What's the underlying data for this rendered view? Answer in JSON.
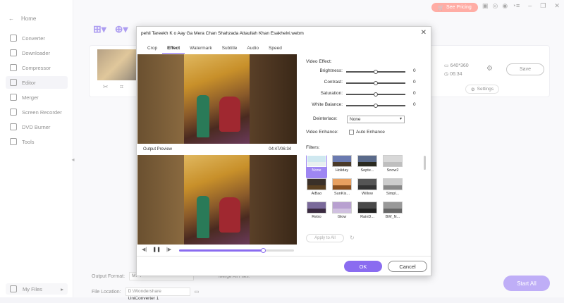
{
  "sidebar": {
    "home": "Home",
    "items": [
      {
        "label": "Converter",
        "icon": "converter-icon"
      },
      {
        "label": "Downloader",
        "icon": "downloader-icon"
      },
      {
        "label": "Compressor",
        "icon": "compressor-icon"
      },
      {
        "label": "Editor",
        "icon": "editor-icon",
        "active": true
      },
      {
        "label": "Merger",
        "icon": "merger-icon"
      },
      {
        "label": "Screen Recorder",
        "icon": "screen-recorder-icon"
      },
      {
        "label": "DVD Burner",
        "icon": "dvd-burner-icon"
      },
      {
        "label": "Tools",
        "icon": "tools-icon"
      }
    ],
    "my_files": "My Files"
  },
  "topbar": {
    "pricing_label": "See Pricing",
    "accent": "#ff6b5c"
  },
  "background": {
    "resolution": "640*360",
    "duration": "06:34",
    "save_label": "Save",
    "settings_label": "Settings",
    "output_format_label": "Output Format:",
    "output_format_value": "MP4",
    "merge_label": "Merge All Files:",
    "file_location_label": "File Location:",
    "file_location_value": "D:\\Wondershare UniConverter 1",
    "start_all_label": "Start All"
  },
  "dialog": {
    "title": "pehli Tareekh K o Aay Ga Mera Chan Shahzada Attaullah Khan Esakhelvi.webm",
    "tabs": [
      "Crop",
      "Effect",
      "Watermark",
      "Subtitle",
      "Audio",
      "Speed"
    ],
    "active_tab": "Effect",
    "output_preview_label": "Output Preview",
    "time": "04:47/06:34",
    "playback_progress": 0.73,
    "video_effect_label": "Video Effect:",
    "sliders": [
      {
        "label": "Brightness:",
        "value": "0",
        "position": 0.5
      },
      {
        "label": "Contrast:",
        "value": "0",
        "position": 0.5
      },
      {
        "label": "Saturation:",
        "value": "0",
        "position": 0.5
      },
      {
        "label": "White Balance:",
        "value": "0",
        "position": 0.5
      }
    ],
    "deinterlace_label": "Deinterlace:",
    "deinterlace_value": "None",
    "video_enhance_label": "Video Enhance:",
    "auto_enhance_label": "Auto Enhance",
    "filters_label": "Filters:",
    "filters": [
      "None",
      "Holiday",
      "Septe...",
      "Snow2",
      "AiBao",
      "SunKis...",
      "Willow",
      "Simpl...",
      "Retro",
      "Glow",
      "RainD...",
      "BW_N..."
    ],
    "selected_filter": "None",
    "apply_all_label": "Apply to All",
    "ok_label": "OK",
    "cancel_label": "Cancel",
    "accent": "#8a6cf0"
  }
}
